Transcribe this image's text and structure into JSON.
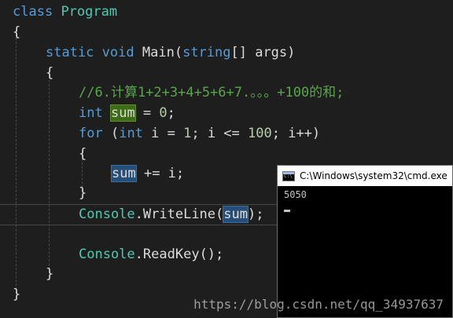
{
  "code": {
    "line1": {
      "kw": "class",
      "name": "Program"
    },
    "line2": {
      "brace": "{"
    },
    "line3": {
      "kw1": "static",
      "kw2": "void",
      "name": "Main",
      "open": "(",
      "type": "string",
      "rest": "[] args)"
    },
    "line4": {
      "brace": "{"
    },
    "line5": {
      "comment": "//6.计算1+2+3+4+5+6+7.。。。+100的和;"
    },
    "line6": {
      "kw": "int",
      "var": "sum",
      "mid": " = ",
      "num": "0",
      "end": ";"
    },
    "line7": {
      "kw": "for",
      "p1": " (",
      "kw2": "int",
      "p2": " i = ",
      "n1": "1",
      "p3": "; i <= ",
      "n2": "100",
      "p4": "; i++)"
    },
    "line8": {
      "brace": "{"
    },
    "line9": {
      "var": "sum",
      "rest": " += i;"
    },
    "line10": {
      "brace": "}"
    },
    "line11": {
      "cls": "Console",
      "dot": ".",
      "method": "WriteLine",
      "open": "(",
      "var": "sum",
      "close": ");"
    },
    "line12": {
      "cls": "Console",
      "dot": ".",
      "method": "ReadKey",
      "rest": "();"
    },
    "line13": {
      "brace": "}"
    },
    "line14": {
      "brace": "}"
    }
  },
  "cmd_window": {
    "title": "C:\\Windows\\system32\\cmd.exe",
    "output": "5050"
  },
  "watermark": "https://blog.csdn.net/qq_34937637",
  "colors": {
    "background": "#1e1e1e",
    "keyword": "#569cd6",
    "type": "#4ec9b0",
    "comment": "#57a64a",
    "number": "#b5cea8",
    "text": "#dcdcdc"
  }
}
